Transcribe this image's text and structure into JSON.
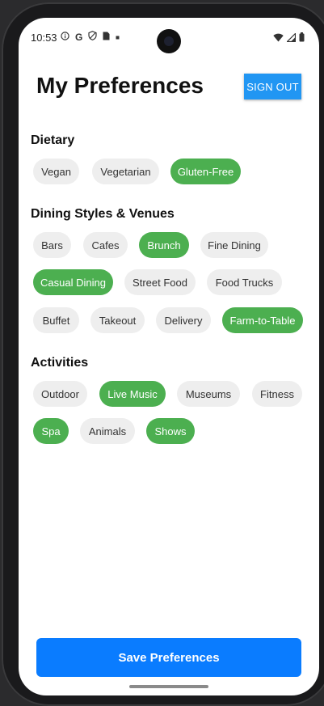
{
  "status": {
    "time": "10:53",
    "left_icons": [
      "info-icon",
      "google-icon",
      "shield-icon",
      "sim-icon",
      "dot-icon"
    ],
    "right_icons": [
      "wifi-icon",
      "signal-icon",
      "battery-icon"
    ]
  },
  "header": {
    "title": "My Preferences",
    "signout_label": "SIGN OUT"
  },
  "sections": {
    "dietary": {
      "title": "Dietary",
      "chips": [
        {
          "label": "Vegan",
          "selected": false
        },
        {
          "label": "Vegetarian",
          "selected": false
        },
        {
          "label": "Gluten-Free",
          "selected": true
        }
      ]
    },
    "dining": {
      "title": "Dining Styles & Venues",
      "chips": [
        {
          "label": "Bars",
          "selected": false
        },
        {
          "label": "Cafes",
          "selected": false
        },
        {
          "label": "Brunch",
          "selected": true
        },
        {
          "label": "Fine Dining",
          "selected": false
        },
        {
          "label": "Casual Dining",
          "selected": true
        },
        {
          "label": "Street Food",
          "selected": false
        },
        {
          "label": "Food Trucks",
          "selected": false
        },
        {
          "label": "Buffet",
          "selected": false
        },
        {
          "label": "Takeout",
          "selected": false
        },
        {
          "label": "Delivery",
          "selected": false
        },
        {
          "label": "Farm-to-Table",
          "selected": true
        }
      ]
    },
    "activities": {
      "title": "Activities",
      "chips": [
        {
          "label": "Outdoor",
          "selected": false
        },
        {
          "label": "Live Music",
          "selected": true
        },
        {
          "label": "Museums",
          "selected": false
        },
        {
          "label": "Fitness",
          "selected": false
        },
        {
          "label": "Spa",
          "selected": true
        },
        {
          "label": "Animals",
          "selected": false
        },
        {
          "label": "Shows",
          "selected": true
        }
      ]
    }
  },
  "footer": {
    "save_label": "Save Preferences"
  },
  "colors": {
    "selected": "#4caf50",
    "unselected": "#eeeeee",
    "primary": "#0a7cff",
    "signout": "#2196f3"
  }
}
